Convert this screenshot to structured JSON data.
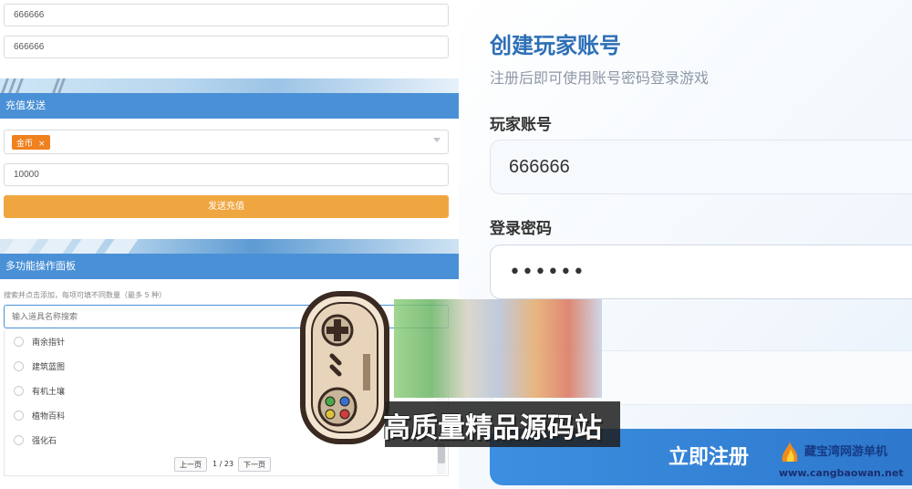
{
  "top_inputs": {
    "field1": "666666",
    "field2": "666666"
  },
  "recharge": {
    "header": "充值发送",
    "currency_tag": "金币",
    "tag_remove": "×",
    "amount": "10000",
    "send_button": "发送充值"
  },
  "panel": {
    "header": "多功能操作面板",
    "hint": "搜索并点击添加，每项可填不同数量（最多 5 种）",
    "search_placeholder": "输入道具名称搜索",
    "items": [
      {
        "label": "南余指针"
      },
      {
        "label": "建筑蓝图"
      },
      {
        "label": "有机土壤"
      },
      {
        "label": "植物百科"
      },
      {
        "label": "强化石"
      }
    ],
    "pager": {
      "prev": "上一页",
      "page": "1 / 23",
      "next": "下一页"
    }
  },
  "register": {
    "title": "创建玩家账号",
    "subtitle": "注册后即可使用账号密码登录游戏",
    "account_label": "玩家账号",
    "account_value": "666666",
    "password_label": "登录密码",
    "password_value": "••••••",
    "submit": "立即注册"
  },
  "watermark": {
    "text": "高质量精品源码站",
    "site_name": "藏宝湾网游单机",
    "site_url": "www.cangbaowan.net"
  },
  "colors": {
    "accent_blue": "#4a90d6",
    "tag_orange": "#f0811f",
    "send_orange": "#f0a640",
    "title_blue": "#2d6fb6",
    "submit_blue": "#2d77cc"
  }
}
